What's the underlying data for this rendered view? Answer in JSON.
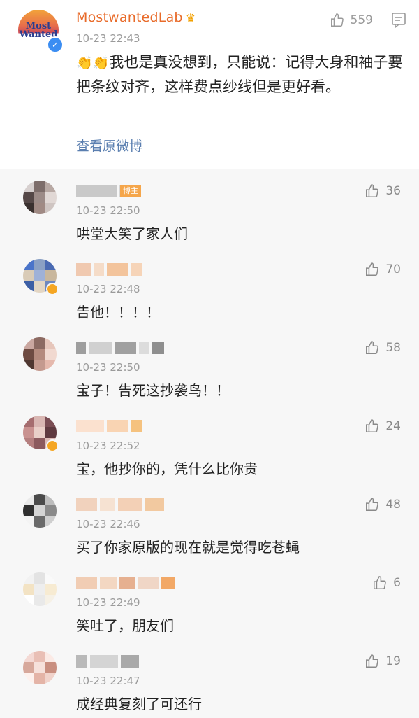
{
  "main_post": {
    "avatar_logo_line1": "Most",
    "avatar_logo_line2": "Wanted",
    "username": "MostwantedLab",
    "time": "10-23 22:43",
    "likes": "559",
    "text": "我也是真没想到，只能说：记得大身和袖子要把条纹对齐，这样费点纱线但是更好看。",
    "view_original": "查看原微博",
    "colors": {
      "username": "#e86b2a",
      "link": "#5b7fb0",
      "verified": "#3b8df2"
    }
  },
  "comments": [
    {
      "time": "10-23 22:50",
      "text": "哄堂大笑了家人们",
      "likes": "36",
      "tag": "博主",
      "verified": false
    },
    {
      "time": "10-23 22:48",
      "text": "告他！！！！",
      "likes": "70",
      "verified": true
    },
    {
      "time": "10-23 22:50",
      "text": "宝子！告死这抄袭鸟！！",
      "likes": "58",
      "verified": false
    },
    {
      "time": "10-23 22:52",
      "text": "宝，他抄你的，凭什么比你贵",
      "likes": "24",
      "verified": true
    },
    {
      "time": "10-23 22:46",
      "text": "买了你家原版的现在就是觉得吃苍蝇",
      "likes": "48",
      "verified": false
    },
    {
      "time": "10-23 22:49",
      "text": "笑吐了，朋友们",
      "likes": "6",
      "verified": false
    },
    {
      "time": "10-23 22:47",
      "text": "成经典复刻了可还行",
      "likes": "19",
      "verified": false
    }
  ]
}
